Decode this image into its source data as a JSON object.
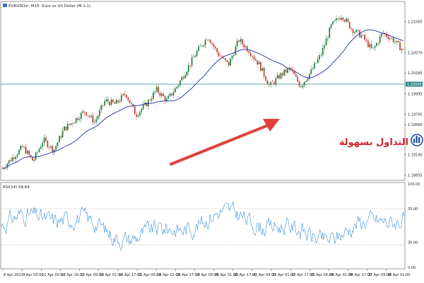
{
  "chart_data": [
    {
      "type": "candlestick",
      "title": "EURUSDm, M15: Euro vs US Dollar (M 1:1)",
      "symbol": "EURUSDm",
      "timeframe": "M15",
      "overlay": "moving average (blue)",
      "ylim": [
        1.188,
        1.2125
      ],
      "y_ticks": [
        1.21005,
        1.2057,
        1.20285,
        1.19995,
        1.19705,
        1.1956,
        1.1914,
        1.18855
      ],
      "price_line": 1.20045,
      "x_ticks": [
        "8 Apr 2021",
        "9 Apr 05:00",
        "12 Apr 00:00",
        "12 Apr 16:00",
        "13 Apr 09:00",
        "14 Apr 01:00",
        "14 Apr 17:00",
        "15 Apr 09:00",
        "16 Apr 01:00",
        "16 Apr 17:00",
        "19 Apr 09:00",
        "20 Apr 01:00",
        "20 Apr 17:00",
        "21 Apr 09:00",
        "22 Apr 01:00",
        "22 Apr 17:00",
        "23 Apr 09:00",
        "26 Apr 01:00",
        "26 Apr 17:00",
        "27 Apr 09:00",
        "28 Apr 01:00"
      ],
      "price_path": [
        1.1895,
        1.191,
        1.1925,
        1.1905,
        1.1935,
        1.192,
        1.195,
        1.1962,
        1.1975,
        1.196,
        1.199,
        1.1985,
        1.2,
        1.197,
        1.1985,
        1.2005,
        1.199,
        1.201,
        1.2035,
        1.206,
        1.208,
        1.2055,
        1.204,
        1.2075,
        1.206,
        1.204,
        1.201,
        1.2025,
        1.2035,
        1.201,
        1.203,
        1.2055,
        1.2095,
        1.211,
        1.209,
        1.208,
        1.206,
        1.2085,
        1.2075,
        1.206
      ]
    },
    {
      "type": "line",
      "title": "RSI(14) 58.64",
      "indicator": "RSI",
      "period": 14,
      "current_value": 58.64,
      "ylim": [
        0,
        100
      ],
      "y_ticks": [
        100.0,
        70.0,
        30.0,
        0.0
      ],
      "levels": [
        70,
        30
      ]
    }
  ],
  "header": {
    "title": "EURUSDm, M15: Euro vs US Dollar (M 1:1)"
  },
  "rsi": {
    "label": "RSI(14) 58.64"
  },
  "price_line_label": "1.20045",
  "logo": {
    "text": "التداول بسهولة"
  },
  "colors": {
    "bull": "#1b7a3e",
    "bear": "#c0392b",
    "ma": "#1a2ea6",
    "rsi": "#3f8fd8",
    "price_line": "#2a8a8a",
    "arrow": "#e0403a",
    "logo_red": "#d8232a",
    "logo_blue": "#1c4fa0"
  }
}
